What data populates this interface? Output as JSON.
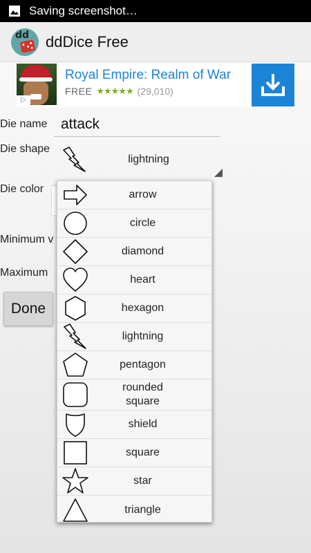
{
  "status_bar": {
    "text": "Saving screenshot…",
    "icon": "image-icon"
  },
  "app": {
    "title": "ddDice Free",
    "logo_text": "dd"
  },
  "ad": {
    "title": "Royal Empire: Realm of War",
    "price": "FREE",
    "stars": "★★★★★",
    "rating_count": "(29,010)",
    "choices_icon": "adchoices-icon",
    "download_icon": "download-icon",
    "star_color": "#7fae1f",
    "accent": "#1c84d6"
  },
  "form": {
    "die_name_label": "Die name",
    "die_name_value": "attack",
    "die_shape_label": "Die shape",
    "die_shape_value": "lightning",
    "die_color_label": "Die color",
    "minimum_label": "Minimum v",
    "maximum_label": "Maximum",
    "done_label": "Done"
  },
  "dropdown": {
    "options": [
      {
        "label": "arrow",
        "icon": "arrow-icon"
      },
      {
        "label": "circle",
        "icon": "circle-icon"
      },
      {
        "label": "diamond",
        "icon": "diamond-icon"
      },
      {
        "label": "heart",
        "icon": "heart-icon"
      },
      {
        "label": "hexagon",
        "icon": "hexagon-icon"
      },
      {
        "label": "lightning",
        "icon": "lightning-icon"
      },
      {
        "label": "pentagon",
        "icon": "pentagon-icon"
      },
      {
        "label": "rounded\nsquare",
        "icon": "rounded-square-icon"
      },
      {
        "label": "shield",
        "icon": "shield-icon"
      },
      {
        "label": "square",
        "icon": "square-icon"
      },
      {
        "label": "star",
        "icon": "star-icon"
      },
      {
        "label": "triangle",
        "icon": "triangle-icon"
      }
    ]
  }
}
